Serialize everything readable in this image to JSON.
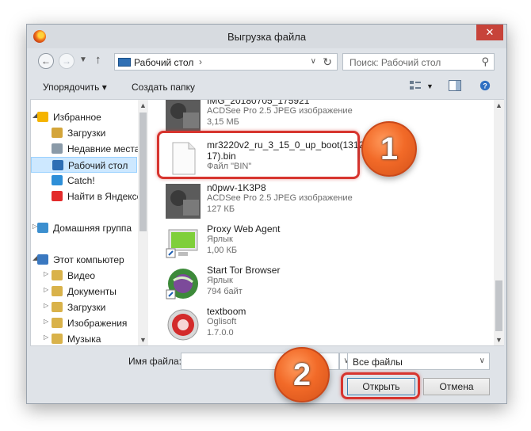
{
  "window": {
    "title": "Выгрузка файла",
    "close_symbol": "✕"
  },
  "address": {
    "path": "Рабочий стол",
    "path_separator": "›",
    "search_placeholder": "Поиск: Рабочий стол"
  },
  "toolbar": {
    "organize": "Упорядочить ▾",
    "new_folder": "Создать папку"
  },
  "navigation": [
    {
      "label": "Избранное",
      "icon": "star-icon",
      "color": "#f5b400",
      "indent": 0,
      "expander": "◢"
    },
    {
      "label": "Загрузки",
      "icon": "downloads-folder-icon",
      "color": "#d4a53a",
      "indent": 1
    },
    {
      "label": "Недавние места",
      "icon": "recent-places-icon",
      "color": "#8a9aa8",
      "indent": 1
    },
    {
      "label": "Рабочий стол",
      "icon": "desktop-icon",
      "color": "#2f6fb4",
      "indent": 1,
      "selected": true
    },
    {
      "label": "Catch!",
      "icon": "catch-icon",
      "color": "#2e8fd8",
      "indent": 1
    },
    {
      "label": "Найти в Яндексе",
      "icon": "yandex-icon",
      "color": "#e32b2b",
      "indent": 1
    },
    {
      "label": "Домашняя группа",
      "icon": "homegroup-icon",
      "color": "#3c8fcf",
      "indent": 0,
      "expander": "▷"
    },
    {
      "label": "Этот компьютер",
      "icon": "computer-icon",
      "color": "#3a78c0",
      "indent": 0,
      "expander": "◢"
    },
    {
      "label": "Видео",
      "icon": "video-folder-icon",
      "color": "#d9b24a",
      "indent": 1,
      "expander": "▷"
    },
    {
      "label": "Документы",
      "icon": "documents-folder-icon",
      "color": "#d9b24a",
      "indent": 1,
      "expander": "▷"
    },
    {
      "label": "Загрузки",
      "icon": "downloads-folder-icon",
      "color": "#d9b24a",
      "indent": 1,
      "expander": "▷"
    },
    {
      "label": "Изображения",
      "icon": "pictures-folder-icon",
      "color": "#d9b24a",
      "indent": 1,
      "expander": "▷"
    },
    {
      "label": "Музыка",
      "icon": "music-folder-icon",
      "color": "#d9b24a",
      "indent": 1,
      "expander": "▷"
    }
  ],
  "files": [
    {
      "name": "IMG_20180705_175921",
      "type": "ACDSee Pro 2.5 JPEG изображение",
      "size": "3,15 МБ",
      "icon": "image-thumbnail-icon"
    },
    {
      "name": "mr3220v2_ru_3_15_0_up_boot(1312\n17).bin",
      "type": "Файл \"BIN\"",
      "size": "",
      "icon": "bin-file-icon",
      "highlighted": true
    },
    {
      "name": "n0pwv-1K3P8",
      "type": "ACDSee Pro 2.5 JPEG изображение",
      "size": "127 КБ",
      "icon": "image-thumbnail-icon"
    },
    {
      "name": "Proxy Web Agent",
      "type": "Ярлык",
      "size": "1,00 КБ",
      "icon": "proxy-web-agent-icon"
    },
    {
      "name": "Start Tor Browser",
      "type": "Ярлык",
      "size": "794 байт",
      "icon": "tor-browser-icon"
    },
    {
      "name": "textboom",
      "type": "Oglisoft",
      "size": "1.7.0.0",
      "icon": "textboom-icon"
    }
  ],
  "bottom": {
    "filename_label": "Имя файла:",
    "filename_value": "",
    "filter": "Все файлы",
    "open": "Открыть",
    "cancel": "Отмена"
  },
  "annotations": {
    "step1": "1",
    "step2": "2",
    "ring_color": "#d7352f"
  }
}
